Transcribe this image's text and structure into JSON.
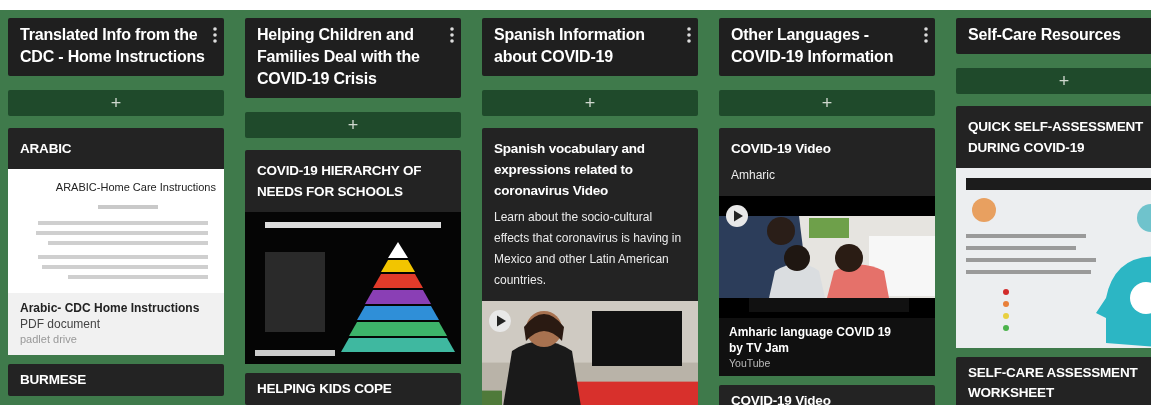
{
  "columns": [
    {
      "title": "Translated Info from the CDC - Home Instructions",
      "menu": true,
      "add_label": "+",
      "posts": [
        {
          "title": "ARABIC",
          "attachment": {
            "kind": "document",
            "preview_title": "ARABIC-Home Care Instructions",
            "name": "Arabic- CDC Home Instructions",
            "type": "PDF document",
            "source": "padlet drive"
          }
        },
        {
          "title": "BURMESE"
        }
      ]
    },
    {
      "title": "Helping Children and Families Deal with the COVID-19 Crisis",
      "menu": true,
      "add_label": "+",
      "posts": [
        {
          "title": "COVID-19 HIERARCHY OF NEEDS FOR SCHOOLS"
        },
        {
          "title": "HELPING KIDS COPE"
        }
      ]
    },
    {
      "title": "Spanish Information about COVID-19",
      "menu": true,
      "add_label": "+",
      "posts": [
        {
          "title": "Spanish vocabulary and expressions related to coronavirus Video",
          "body": "Learn about the socio-cultural effects that coronavirus is having in Mexico and other Latin American countries.",
          "attachment": {
            "kind": "video"
          }
        }
      ]
    },
    {
      "title": "Other Languages - COVID-19 Information",
      "menu": true,
      "add_label": "+",
      "posts": [
        {
          "title": "COVID-19 Video",
          "body": "Amharic",
          "attachment": {
            "kind": "video",
            "name": "Amharic language COVID 19",
            "byline": "by TV Jam",
            "source": "YouTube"
          }
        },
        {
          "title": "COVID-19 Video"
        }
      ]
    },
    {
      "title": "Self-Care Resources",
      "menu": false,
      "add_label": "+",
      "posts": [
        {
          "title": "QUICK SELF-ASSESSMENT DURING COVID-19"
        },
        {
          "title": "SELF-CARE ASSESSMENT WORKSHEET"
        }
      ]
    }
  ]
}
